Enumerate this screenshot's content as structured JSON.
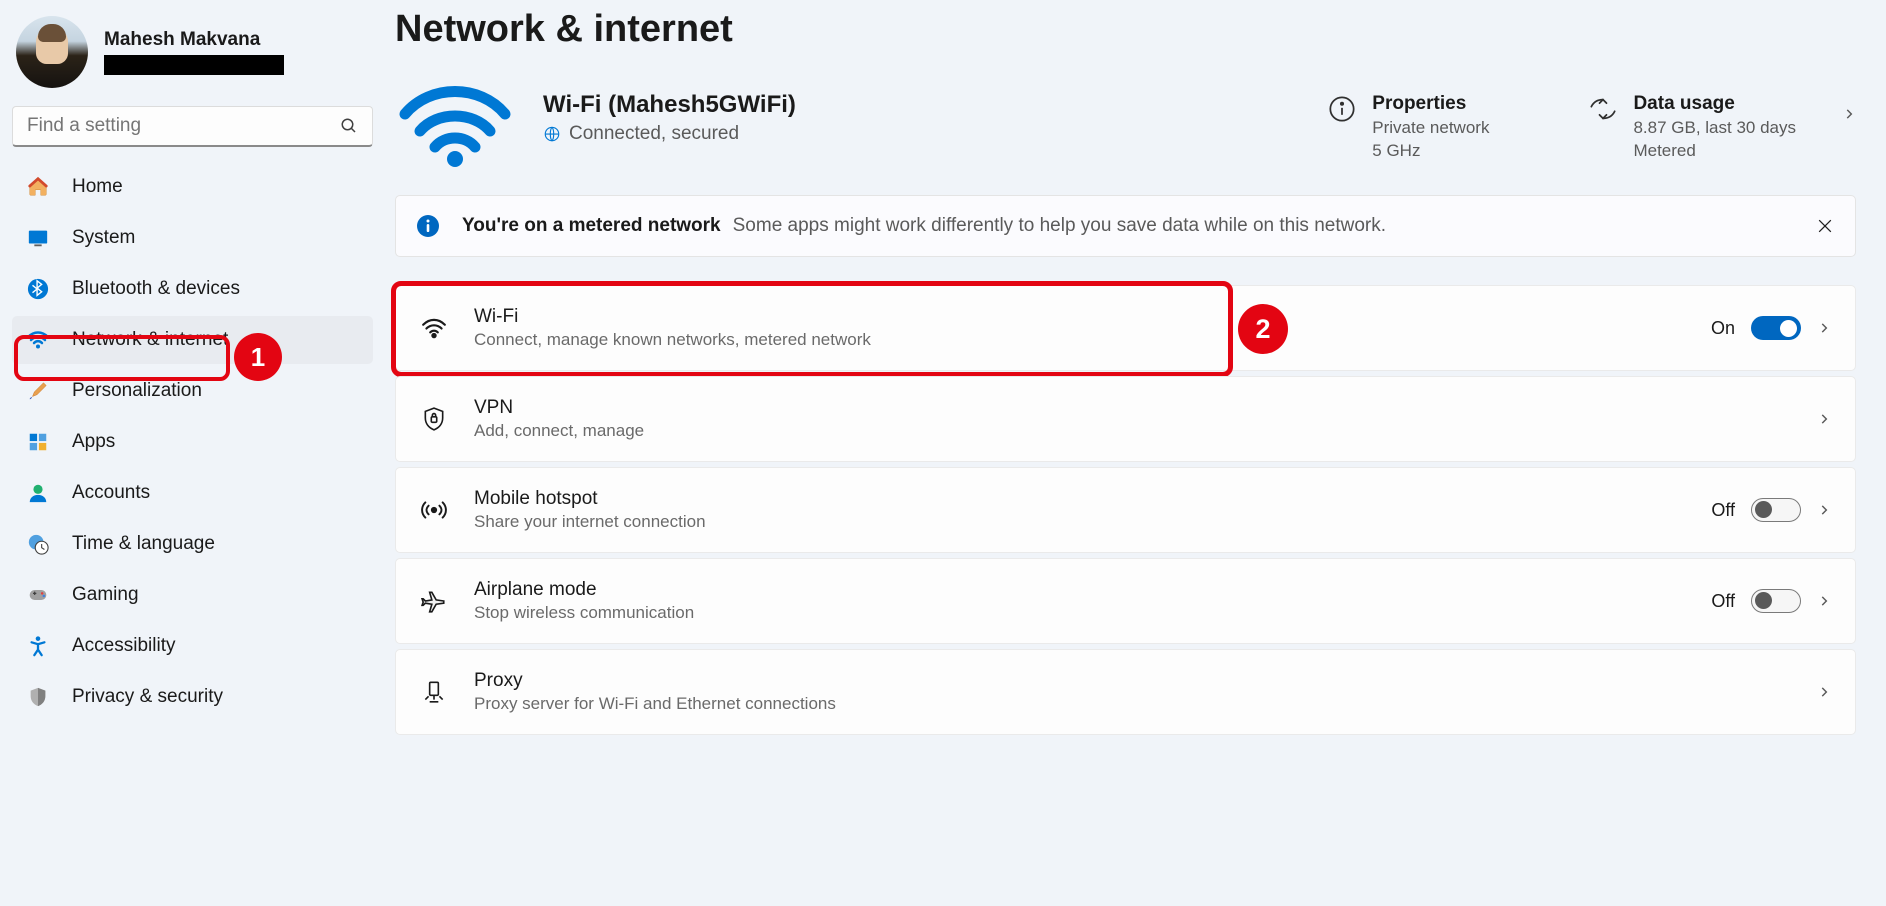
{
  "user": {
    "name": "Mahesh Makvana"
  },
  "search": {
    "placeholder": "Find a setting"
  },
  "sidebar": {
    "items": [
      {
        "label": "Home"
      },
      {
        "label": "System"
      },
      {
        "label": "Bluetooth & devices"
      },
      {
        "label": "Network & internet"
      },
      {
        "label": "Personalization"
      },
      {
        "label": "Apps"
      },
      {
        "label": "Accounts"
      },
      {
        "label": "Time & language"
      },
      {
        "label": "Gaming"
      },
      {
        "label": "Accessibility"
      },
      {
        "label": "Privacy & security"
      }
    ]
  },
  "page": {
    "title": "Network & internet"
  },
  "wifi": {
    "name": "Wi-Fi (Mahesh5GWiFi)",
    "status": "Connected, secured"
  },
  "properties": {
    "title": "Properties",
    "line1": "Private network",
    "line2": "5 GHz"
  },
  "datausage": {
    "title": "Data usage",
    "line1": "8.87 GB, last 30 days",
    "line2": "Metered"
  },
  "banner": {
    "bold": "You're on a metered network",
    "text": "Some apps might work differently to help you save data while on this network."
  },
  "cards": {
    "wifi": {
      "title": "Wi-Fi",
      "sub": "Connect, manage known networks, metered network",
      "toggle": "On"
    },
    "vpn": {
      "title": "VPN",
      "sub": "Add, connect, manage"
    },
    "hotspot": {
      "title": "Mobile hotspot",
      "sub": "Share your internet connection",
      "toggle": "Off"
    },
    "airplane": {
      "title": "Airplane mode",
      "sub": "Stop wireless communication",
      "toggle": "Off"
    },
    "proxy": {
      "title": "Proxy",
      "sub": "Proxy server for Wi-Fi and Ethernet connections"
    }
  },
  "annotations": {
    "badge1": "1",
    "badge2": "2"
  }
}
